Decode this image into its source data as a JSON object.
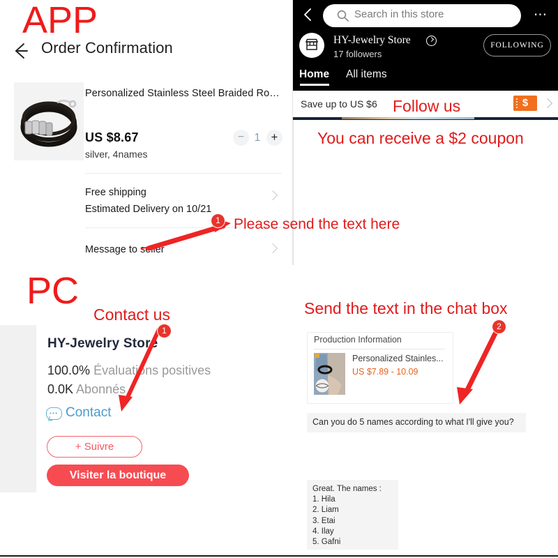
{
  "annotations": {
    "app_label": "APP",
    "pc_label": "PC",
    "follow_us": "Follow us",
    "coupon_note": "You can receive a $2 coupon",
    "send_text_here": "Please send the text here",
    "contact_us": "Contact us",
    "chat_box_note": "Send the text in the chat box",
    "badge_1": "1",
    "badge_1b": "1",
    "badge_2": "2",
    "accent_color": "#e01b1b"
  },
  "app": {
    "back_icon": "arrow-left-icon",
    "title": "Order Confirmation",
    "product": {
      "title": "Personalized Stainless Steel Braided Rop...",
      "price": "US $8.67",
      "variant": "silver,  4names",
      "qty_minus": "−",
      "qty_value": "1",
      "qty_plus": "+"
    },
    "rows": [
      {
        "label": "Free shipping",
        "sub": "Estimated Delivery on 10/21"
      },
      {
        "label": "Message to seller",
        "sub": ""
      }
    ]
  },
  "store": {
    "back_icon": "chevron-left-icon",
    "search_placeholder": "Search in this store",
    "more_icon": "more-horizontal-icon",
    "avatar_icon": "storefront-icon",
    "name": "HY-Jewelry Store",
    "verified_icon": "verified-check-icon",
    "followers": "17 followers",
    "follow_button": "FOLLOWING",
    "tabs": [
      {
        "label": "Home",
        "active": true
      },
      {
        "label": "All items",
        "active": false
      }
    ],
    "coupon": {
      "save_text": "Save up to US $6",
      "ticket_icon": "coupon-dollar-icon",
      "ticket_symbol": "$",
      "chevron_icon": "chevron-right-icon"
    }
  },
  "pc": {
    "store_name": "HY-Jewelry Store",
    "rating_value": "100.0%",
    "rating_label": "Évaluations positives",
    "followers_value": "0.0K",
    "followers_label": "Abonnés",
    "contact_icon": "chat-bubble-icon",
    "contact_label": "Contact",
    "follow_button": "+ Suivre",
    "visit_button": "Visiter la boutique"
  },
  "chat": {
    "product_card": {
      "header": "Production Information",
      "thumb_icon": "product-photo",
      "name": "Personalized Stainles...",
      "price": "US $7.89 - 10.09"
    },
    "messages": [
      {
        "text": "Can you do 5 names according to what I'll give you?"
      },
      {
        "text": "Great. The names :\n1. Hila\n2. Liam\n3. Etai\n4. Ilay\n5. Gafni"
      }
    ]
  }
}
